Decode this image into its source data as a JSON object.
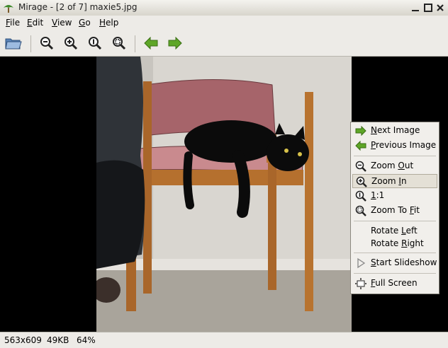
{
  "window": {
    "title": "Mirage - [2 of 7] maxie5.jpg"
  },
  "menubar": {
    "items": [
      {
        "label": "File",
        "accel": "F",
        "rest": "ile"
      },
      {
        "label": "Edit",
        "accel": "E",
        "rest": "dit"
      },
      {
        "label": "View",
        "accel": "V",
        "rest": "iew"
      },
      {
        "label": "Go",
        "accel": "G",
        "rest": "o"
      },
      {
        "label": "Help",
        "accel": "H",
        "rest": "elp"
      }
    ]
  },
  "toolbar": {
    "icons": [
      "open-folder-icon",
      "zoom-out-icon",
      "zoom-in-icon",
      "zoom-1to1-icon",
      "zoom-fit-icon",
      "previous-arrow-icon",
      "next-arrow-icon"
    ]
  },
  "status": {
    "dimensions": "563x609",
    "size": "49KB",
    "zoom": "64%"
  },
  "context_menu": {
    "next_image": {
      "pre": "",
      "accel": "N",
      "post": "ext Image"
    },
    "previous_image": {
      "pre": "",
      "accel": "P",
      "post": "revious Image"
    },
    "zoom_out": {
      "pre": "Zoom ",
      "accel": "O",
      "post": "ut"
    },
    "zoom_in": {
      "pre": "Zoom ",
      "accel": "I",
      "post": "n"
    },
    "one_to_one": {
      "pre": "",
      "accel": "1",
      "post": ":1"
    },
    "zoom_to_fit": {
      "pre": "Zoom To ",
      "accel": "F",
      "post": "it"
    },
    "rotate_left": {
      "pre": "Rotate ",
      "accel": "L",
      "post": "eft"
    },
    "rotate_right": {
      "pre": "Rotate ",
      "accel": "R",
      "post": "ight"
    },
    "start_slideshow": {
      "pre": "",
      "accel": "S",
      "post": "tart Slideshow"
    },
    "full_screen": {
      "pre": "",
      "accel": "F",
      "post": "ull Screen"
    }
  },
  "colors": {
    "arrow_green": "#5ea627",
    "highlight": "#e4e0d6"
  }
}
